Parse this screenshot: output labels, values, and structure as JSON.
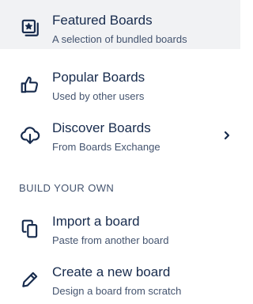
{
  "menu": {
    "items": [
      {
        "title": "Featured Boards",
        "subtitle": "A selection of bundled boards",
        "icon": "featured-board-icon",
        "active": true
      },
      {
        "title": "Popular Boards",
        "subtitle": "Used by other users",
        "icon": "thumbs-up-icon"
      },
      {
        "title": "Discover Boards",
        "subtitle": "From Boards Exchange",
        "icon": "cloud-download-icon",
        "has_submenu": true
      }
    ],
    "section_header": "BUILD YOUR OWN",
    "build_items": [
      {
        "title": "Import a board",
        "subtitle": "Paste from another board",
        "icon": "copy-icon"
      },
      {
        "title": "Create a new board",
        "subtitle": "Design a board from scratch",
        "icon": "pencil-icon"
      }
    ]
  },
  "colors": {
    "active_background": "#f1f2f4",
    "title_text": "#172b4d",
    "subtitle_text": "#44546f"
  }
}
